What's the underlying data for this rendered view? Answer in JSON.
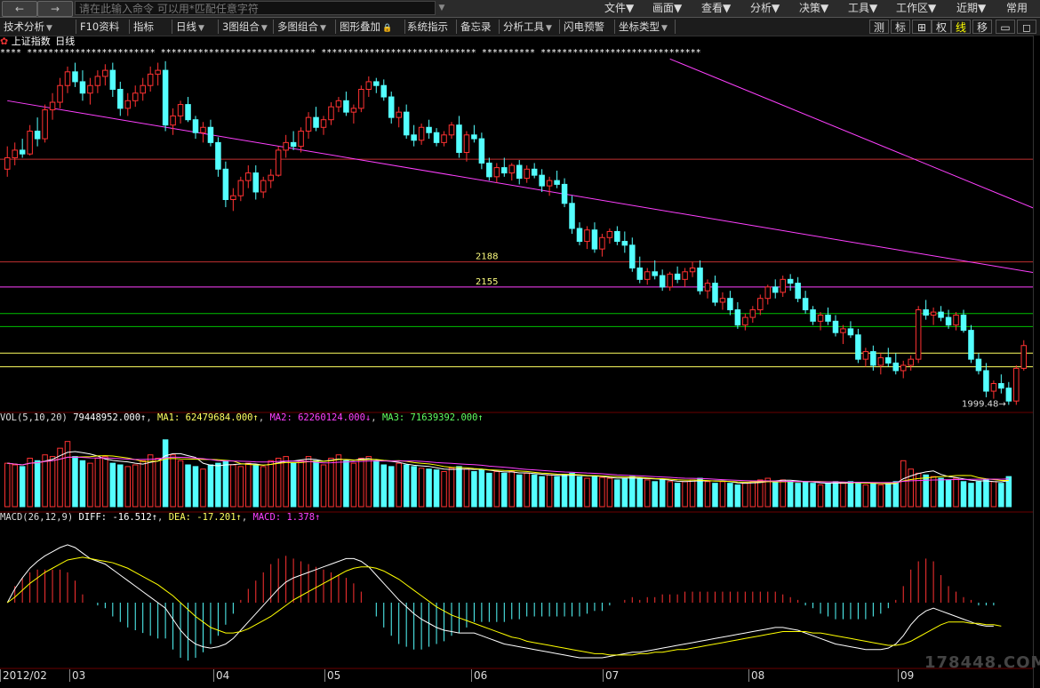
{
  "topbar": {
    "nav_back": "←",
    "nav_fwd": "→",
    "command_placeholder": "请在此输入命令 可以用*匹配任意字符",
    "menus": [
      "文件▼",
      "画面▼",
      "查看▼",
      "分析▼",
      "决策▼",
      "工具▼",
      "工作区▼",
      "近期▼",
      "常用"
    ]
  },
  "toolbar": {
    "items": [
      "技术分析",
      "F10资料",
      "指标",
      "日线",
      "3图组合",
      "多图组合",
      "图形叠加",
      "系统指示",
      "备忘录",
      "分析工具",
      "闪电预警",
      "坐标类型"
    ],
    "right_items": [
      "测",
      "标",
      "⊞",
      "权",
      "线",
      "移",
      "▭",
      "◻"
    ]
  },
  "header": {
    "index_name": "上证指数",
    "period": "日线",
    "dots": "**** ************************ ***************************** ***************************** ********** ******************************"
  },
  "price_panel": {
    "price_labels": [
      "2188",
      "2155"
    ],
    "low_label": "1999.48→"
  },
  "vol_panel": {
    "name": "VOL(5,10,20)",
    "value": "79448952.000↑",
    "ma1": "MA1: 62479684.000↑",
    "ma2": "MA2: 62260124.000↓",
    "ma3": "MA3: 71639392.000↑"
  },
  "macd_panel": {
    "name": "MACD(26,12,9)",
    "diff": "DIFF: -16.512↑",
    "dea": "DEA: -17.201↑",
    "macd": "MACD: 1.378↑"
  },
  "bottom": {
    "dates": [
      "2012/02",
      "03",
      "04",
      "05",
      "06",
      "07",
      "08",
      "09"
    ]
  },
  "watermark": "178448.COM",
  "colors": {
    "up": "#ff3232",
    "down": "#54ffff",
    "ma_white": "#ffffff",
    "ma_yellow": "#ffff00",
    "ma_magenta": "#ff40ff",
    "ma_green": "#00ff00",
    "hline_red": "#c03030",
    "hline_magenta": "#ff40ff",
    "hline_green": "#00c000",
    "hline_yellow": "#ffff60"
  },
  "chart_data": {
    "type": "candlestick",
    "note_period": "daily",
    "price_range": [
      1990,
      2460
    ],
    "horizontal_levels": [
      {
        "value": 2188,
        "label": "2188",
        "color": "#c03030"
      },
      {
        "value": 2155,
        "label": "2155",
        "color": "#ff40ff"
      },
      {
        "value": 2120,
        "label": "",
        "color": "#00c000"
      },
      {
        "value": 2103,
        "label": "",
        "color": "#00c000"
      },
      {
        "value": 2068,
        "label": "",
        "color": "#ffff60"
      },
      {
        "value": 2050,
        "label": "",
        "color": "#ffff60"
      },
      {
        "value": 2323,
        "label": "",
        "color": "#c03030"
      }
    ],
    "trend_lines": [
      {
        "color": "#ff40ff",
        "from": [
          0,
          2400
        ],
        "to": [
          205,
          2060
        ]
      },
      {
        "color": "#ff40ff",
        "from": [
          88,
          2455
        ],
        "to": [
          200,
          2000
        ]
      }
    ],
    "candles": [
      [
        2310,
        2340,
        2300,
        2325
      ],
      [
        2325,
        2345,
        2315,
        2335
      ],
      [
        2335,
        2350,
        2325,
        2330
      ],
      [
        2330,
        2368,
        2328,
        2360
      ],
      [
        2360,
        2378,
        2340,
        2350
      ],
      [
        2350,
        2395,
        2345,
        2388
      ],
      [
        2388,
        2410,
        2375,
        2398
      ],
      [
        2398,
        2430,
        2390,
        2420
      ],
      [
        2420,
        2445,
        2410,
        2438
      ],
      [
        2438,
        2450,
        2418,
        2425
      ],
      [
        2425,
        2440,
        2400,
        2410
      ],
      [
        2410,
        2430,
        2395,
        2420
      ],
      [
        2420,
        2440,
        2410,
        2432
      ],
      [
        2432,
        2448,
        2420,
        2440
      ],
      [
        2440,
        2450,
        2405,
        2415
      ],
      [
        2415,
        2425,
        2380,
        2390
      ],
      [
        2390,
        2410,
        2380,
        2400
      ],
      [
        2400,
        2420,
        2392,
        2410
      ],
      [
        2410,
        2430,
        2400,
        2420
      ],
      [
        2420,
        2445,
        2412,
        2435
      ],
      [
        2435,
        2450,
        2420,
        2440
      ],
      [
        2440,
        2452,
        2360,
        2368
      ],
      [
        2368,
        2390,
        2355,
        2380
      ],
      [
        2380,
        2400,
        2370,
        2395
      ],
      [
        2395,
        2405,
        2372,
        2375
      ],
      [
        2375,
        2380,
        2350,
        2358
      ],
      [
        2358,
        2372,
        2345,
        2365
      ],
      [
        2365,
        2375,
        2340,
        2345
      ],
      [
        2345,
        2352,
        2300,
        2310
      ],
      [
        2310,
        2320,
        2260,
        2270
      ],
      [
        2270,
        2285,
        2255,
        2275
      ],
      [
        2275,
        2300,
        2268,
        2295
      ],
      [
        2295,
        2315,
        2285,
        2305
      ],
      [
        2305,
        2315,
        2270,
        2280
      ],
      [
        2280,
        2300,
        2272,
        2295
      ],
      [
        2295,
        2310,
        2285,
        2302
      ],
      [
        2302,
        2340,
        2300,
        2335
      ],
      [
        2335,
        2355,
        2325,
        2345
      ],
      [
        2345,
        2360,
        2335,
        2340
      ],
      [
        2340,
        2365,
        2332,
        2360
      ],
      [
        2360,
        2385,
        2350,
        2378
      ],
      [
        2378,
        2392,
        2360,
        2365
      ],
      [
        2365,
        2380,
        2355,
        2375
      ],
      [
        2375,
        2398,
        2368,
        2392
      ],
      [
        2392,
        2405,
        2385,
        2400
      ],
      [
        2400,
        2412,
        2380,
        2385
      ],
      [
        2385,
        2395,
        2370,
        2390
      ],
      [
        2390,
        2420,
        2385,
        2415
      ],
      [
        2415,
        2432,
        2405,
        2425
      ],
      [
        2425,
        2430,
        2410,
        2420
      ],
      [
        2420,
        2428,
        2400,
        2405
      ],
      [
        2405,
        2412,
        2370,
        2378
      ],
      [
        2378,
        2392,
        2365,
        2385
      ],
      [
        2385,
        2395,
        2350,
        2355
      ],
      [
        2355,
        2368,
        2340,
        2348
      ],
      [
        2348,
        2370,
        2342,
        2365
      ],
      [
        2365,
        2375,
        2350,
        2358
      ],
      [
        2358,
        2364,
        2340,
        2345
      ],
      [
        2345,
        2360,
        2340,
        2355
      ],
      [
        2355,
        2372,
        2350,
        2368
      ],
      [
        2368,
        2380,
        2325,
        2332
      ],
      [
        2332,
        2360,
        2320,
        2355
      ],
      [
        2355,
        2368,
        2345,
        2350
      ],
      [
        2350,
        2358,
        2310,
        2318
      ],
      [
        2318,
        2325,
        2295,
        2300
      ],
      [
        2300,
        2318,
        2292,
        2312
      ],
      [
        2312,
        2325,
        2300,
        2305
      ],
      [
        2305,
        2318,
        2295,
        2315
      ],
      [
        2315,
        2322,
        2290,
        2298
      ],
      [
        2298,
        2315,
        2292,
        2310
      ],
      [
        2310,
        2318,
        2298,
        2302
      ],
      [
        2302,
        2310,
        2280,
        2288
      ],
      [
        2288,
        2300,
        2275,
        2295
      ],
      [
        2295,
        2308,
        2285,
        2290
      ],
      [
        2290,
        2298,
        2260,
        2265
      ],
      [
        2265,
        2275,
        2225,
        2232
      ],
      [
        2232,
        2240,
        2210,
        2215
      ],
      [
        2215,
        2235,
        2205,
        2230
      ],
      [
        2230,
        2240,
        2200,
        2205
      ],
      [
        2205,
        2225,
        2195,
        2220
      ],
      [
        2220,
        2232,
        2212,
        2228
      ],
      [
        2228,
        2235,
        2210,
        2215
      ],
      [
        2215,
        2228,
        2200,
        2210
      ],
      [
        2210,
        2220,
        2175,
        2180
      ],
      [
        2180,
        2195,
        2160,
        2165
      ],
      [
        2165,
        2180,
        2158,
        2175
      ],
      [
        2175,
        2190,
        2165,
        2170
      ],
      [
        2170,
        2178,
        2150,
        2155
      ],
      [
        2155,
        2175,
        2150,
        2172
      ],
      [
        2172,
        2182,
        2160,
        2165
      ],
      [
        2165,
        2180,
        2155,
        2175
      ],
      [
        2175,
        2188,
        2168,
        2180
      ],
      [
        2180,
        2190,
        2145,
        2150
      ],
      [
        2150,
        2165,
        2140,
        2160
      ],
      [
        2160,
        2170,
        2130,
        2135
      ],
      [
        2135,
        2148,
        2125,
        2140
      ],
      [
        2140,
        2150,
        2118,
        2125
      ],
      [
        2125,
        2135,
        2100,
        2105
      ],
      [
        2105,
        2120,
        2098,
        2115
      ],
      [
        2115,
        2130,
        2108,
        2125
      ],
      [
        2125,
        2145,
        2118,
        2140
      ],
      [
        2140,
        2158,
        2132,
        2155
      ],
      [
        2155,
        2165,
        2140,
        2148
      ],
      [
        2148,
        2170,
        2142,
        2165
      ],
      [
        2165,
        2172,
        2150,
        2160
      ],
      [
        2160,
        2168,
        2135,
        2140
      ],
      [
        2140,
        2150,
        2120,
        2125
      ],
      [
        2125,
        2130,
        2105,
        2110
      ],
      [
        2110,
        2122,
        2098,
        2118
      ],
      [
        2118,
        2128,
        2105,
        2110
      ],
      [
        2110,
        2118,
        2090,
        2095
      ],
      [
        2095,
        2105,
        2080,
        2100
      ],
      [
        2100,
        2110,
        2088,
        2092
      ],
      [
        2092,
        2100,
        2055,
        2060
      ],
      [
        2060,
        2075,
        2050,
        2070
      ],
      [
        2070,
        2078,
        2045,
        2052
      ],
      [
        2052,
        2068,
        2040,
        2062
      ],
      [
        2062,
        2075,
        2050,
        2055
      ],
      [
        2055,
        2068,
        2040,
        2045
      ],
      [
        2045,
        2058,
        2035,
        2052
      ],
      [
        2052,
        2065,
        2045,
        2060
      ],
      [
        2060,
        2130,
        2055,
        2125
      ],
      [
        2125,
        2138,
        2112,
        2118
      ],
      [
        2118,
        2128,
        2105,
        2122
      ],
      [
        2122,
        2130,
        2110,
        2115
      ],
      [
        2115,
        2125,
        2100,
        2105
      ],
      [
        2105,
        2122,
        2098,
        2118
      ],
      [
        2118,
        2125,
        2095,
        2098
      ],
      [
        2098,
        2105,
        2055,
        2060
      ],
      [
        2060,
        2068,
        2040,
        2045
      ],
      [
        2045,
        2055,
        2010,
        2018
      ],
      [
        2018,
        2032,
        2008,
        2028
      ],
      [
        2028,
        2040,
        2015,
        2022
      ],
      [
        2022,
        2030,
        2000,
        2005
      ],
      [
        2005,
        2052,
        2000,
        2048
      ],
      [
        2048,
        2085,
        2045,
        2078
      ]
    ],
    "volumes": [
      0.52,
      0.5,
      0.48,
      0.58,
      0.55,
      0.62,
      0.6,
      0.7,
      0.78,
      0.6,
      0.55,
      0.52,
      0.58,
      0.6,
      0.52,
      0.5,
      0.48,
      0.5,
      0.55,
      0.62,
      0.58,
      0.8,
      0.62,
      0.55,
      0.5,
      0.48,
      0.45,
      0.5,
      0.52,
      0.55,
      0.5,
      0.48,
      0.52,
      0.5,
      0.48,
      0.55,
      0.58,
      0.6,
      0.52,
      0.55,
      0.6,
      0.55,
      0.5,
      0.58,
      0.62,
      0.55,
      0.52,
      0.58,
      0.6,
      0.55,
      0.5,
      0.48,
      0.52,
      0.5,
      0.48,
      0.46,
      0.45,
      0.44,
      0.42,
      0.46,
      0.48,
      0.45,
      0.42,
      0.44,
      0.4,
      0.42,
      0.4,
      0.42,
      0.38,
      0.4,
      0.38,
      0.36,
      0.38,
      0.36,
      0.38,
      0.4,
      0.36,
      0.34,
      0.36,
      0.35,
      0.34,
      0.32,
      0.34,
      0.36,
      0.34,
      0.32,
      0.3,
      0.32,
      0.3,
      0.28,
      0.3,
      0.32,
      0.34,
      0.3,
      0.28,
      0.3,
      0.28,
      0.26,
      0.28,
      0.3,
      0.32,
      0.34,
      0.3,
      0.32,
      0.3,
      0.28,
      0.3,
      0.28,
      0.26,
      0.28,
      0.3,
      0.28,
      0.3,
      0.28,
      0.26,
      0.28,
      0.26,
      0.28,
      0.3,
      0.55,
      0.45,
      0.4,
      0.38,
      0.36,
      0.34,
      0.32,
      0.34,
      0.3,
      0.28,
      0.3,
      0.32,
      0.3,
      0.28,
      0.36
    ],
    "macd_diff": [
      0,
      10,
      18,
      25,
      30,
      34,
      37,
      40,
      42,
      40,
      36,
      32,
      30,
      28,
      24,
      20,
      16,
      12,
      8,
      4,
      0,
      -4,
      -12,
      -20,
      -26,
      -30,
      -32,
      -33,
      -32,
      -30,
      -26,
      -20,
      -14,
      -8,
      -2,
      4,
      10,
      15,
      18,
      20,
      22,
      24,
      26,
      28,
      30,
      32,
      32,
      30,
      26,
      20,
      14,
      8,
      2,
      -3,
      -8,
      -12,
      -15,
      -18,
      -20,
      -21,
      -22,
      -22,
      -22,
      -24,
      -26,
      -28,
      -30,
      -31,
      -32,
      -33,
      -34,
      -35,
      -36,
      -37,
      -38,
      -39,
      -40,
      -40,
      -40,
      -40,
      -39,
      -38,
      -37,
      -36,
      -36,
      -35,
      -34,
      -33,
      -32,
      -31,
      -30,
      -29,
      -28,
      -27,
      -26,
      -25,
      -24,
      -23,
      -22,
      -21,
      -20,
      -19,
      -18,
      -18,
      -19,
      -20,
      -22,
      -24,
      -26,
      -28,
      -30,
      -31,
      -32,
      -33,
      -34,
      -34,
      -34,
      -33,
      -30,
      -24,
      -16,
      -10,
      -6,
      -4,
      -6,
      -8,
      -10,
      -12,
      -14,
      -16,
      -17,
      -17
    ],
    "macd_dea": [
      0,
      4,
      9,
      14,
      18,
      22,
      25,
      28,
      31,
      32,
      33,
      32,
      31,
      30,
      29,
      27,
      25,
      22,
      19,
      16,
      13,
      9,
      5,
      0,
      -5,
      -10,
      -14,
      -18,
      -20,
      -22,
      -22,
      -21,
      -19,
      -16,
      -13,
      -10,
      -6,
      -2,
      2,
      5,
      8,
      11,
      14,
      17,
      20,
      23,
      25,
      26,
      26,
      25,
      23,
      20,
      17,
      13,
      9,
      5,
      1,
      -3,
      -6,
      -9,
      -11,
      -13,
      -15,
      -17,
      -19,
      -21,
      -23,
      -25,
      -26,
      -28,
      -29,
      -30,
      -31,
      -32,
      -33,
      -34,
      -35,
      -36,
      -37,
      -37,
      -38,
      -38,
      -38,
      -38,
      -37,
      -37,
      -36,
      -36,
      -35,
      -34,
      -34,
      -33,
      -32,
      -31,
      -30,
      -29,
      -28,
      -27,
      -26,
      -25,
      -24,
      -23,
      -22,
      -21,
      -21,
      -21,
      -21,
      -22,
      -22,
      -23,
      -24,
      -25,
      -26,
      -27,
      -28,
      -29,
      -30,
      -31,
      -31,
      -30,
      -28,
      -25,
      -22,
      -19,
      -16,
      -14,
      -14,
      -14,
      -15,
      -15,
      -16,
      -16,
      -17
    ]
  }
}
